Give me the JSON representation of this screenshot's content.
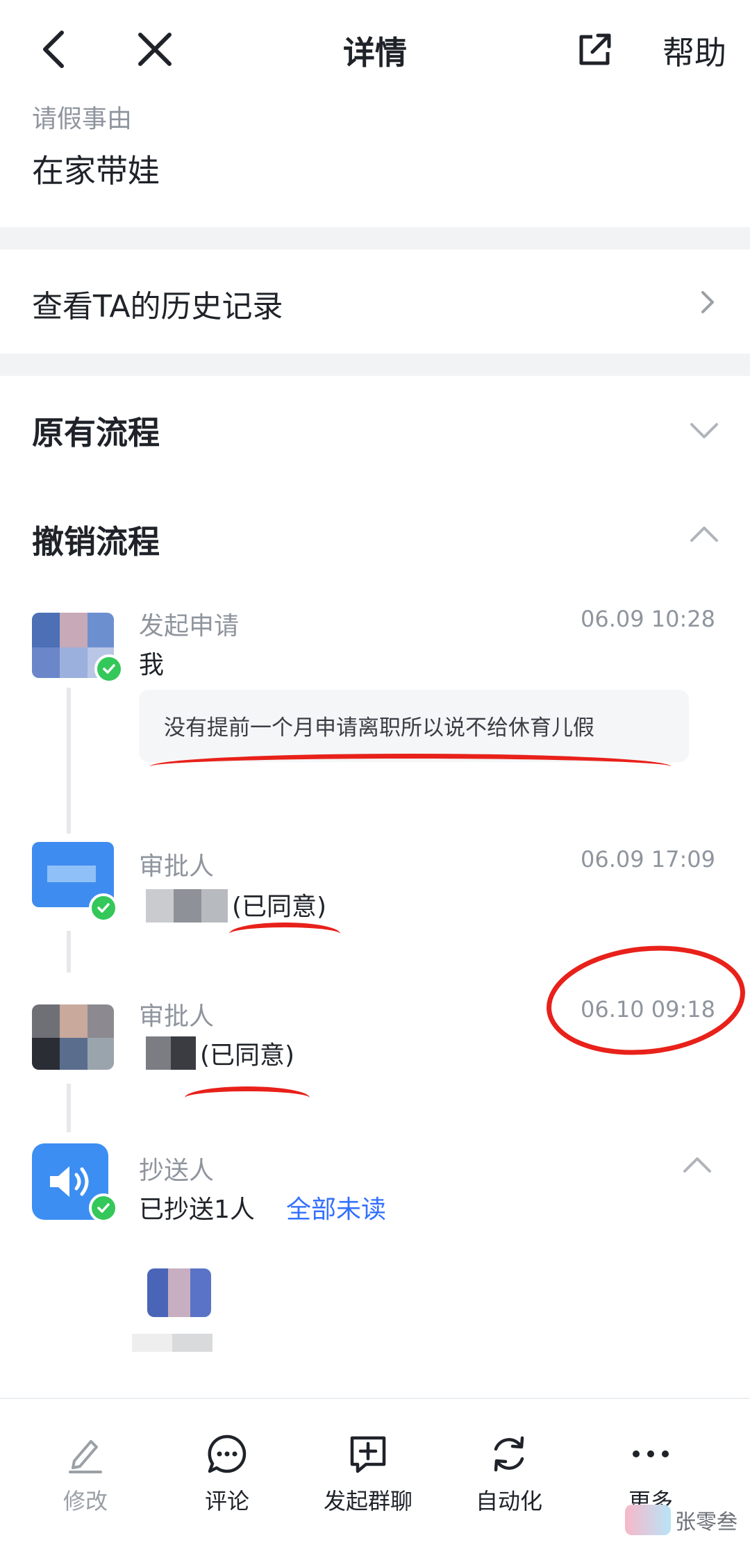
{
  "header": {
    "title": "详情",
    "help_label": "帮助"
  },
  "reason": {
    "label": "请假事由",
    "value": "在家带娃"
  },
  "history": {
    "label": "查看TA的历史记录"
  },
  "sections": {
    "original": "原有流程",
    "revoke": "撤销流程"
  },
  "steps": [
    {
      "label": "发起申请",
      "time": "06.09 10:28",
      "name": "我",
      "comment": "没有提前一个月申请离职所以说不给休育儿假"
    },
    {
      "label": "审批人",
      "time": "06.09 17:09",
      "status": "(已同意)"
    },
    {
      "label": "审批人",
      "time": "06.10 09:18",
      "status": "(已同意)"
    },
    {
      "label": "抄送人",
      "cc_text": "已抄送1人",
      "cc_link": "全部未读"
    }
  ],
  "bottom_tabs": [
    {
      "label": "修改",
      "icon": "edit-icon",
      "enabled": false
    },
    {
      "label": "评论",
      "icon": "comment-icon",
      "enabled": true
    },
    {
      "label": "发起群聊",
      "icon": "group-chat-icon",
      "enabled": true
    },
    {
      "label": "自动化",
      "icon": "automation-icon",
      "enabled": true
    },
    {
      "label": "更多",
      "icon": "more-icon",
      "enabled": true
    }
  ],
  "watermark": {
    "text": "张零叁"
  },
  "colors": {
    "accent": "#3370ff",
    "success": "#34c759",
    "annotation": "#e8211a"
  }
}
